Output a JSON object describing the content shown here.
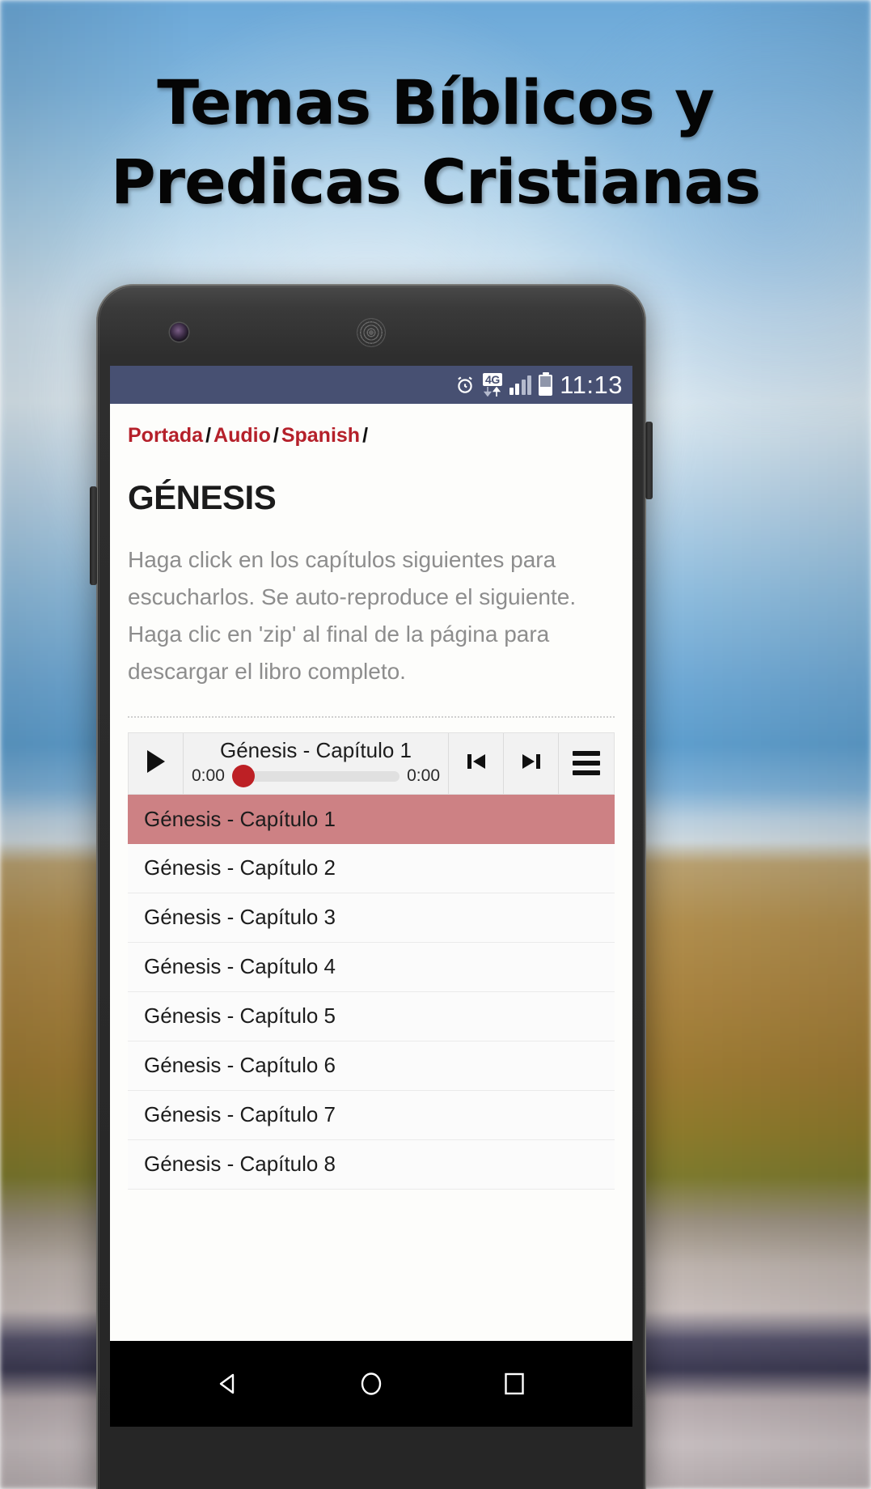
{
  "promo": {
    "headline": "Temas Bíblicos y Predicas Cristianas"
  },
  "statusbar": {
    "alarm_icon": "alarm-clock-icon",
    "network_label": "4G",
    "signal_icon": "signal-bars-icon",
    "battery_icon": "battery-icon",
    "time": "11:13",
    "background_color": "#475072"
  },
  "breadcrumb": {
    "items": [
      {
        "label": "Portada"
      },
      {
        "label": "Audio"
      },
      {
        "label": "Spanish"
      }
    ],
    "separator": "/",
    "link_color": "#b5202a"
  },
  "page": {
    "title": "GÉNESIS",
    "intro": "Haga click en los capítulos siguientes para escucharlos. Se auto-reproduce el siguiente. Haga clic en 'zip' al final de la página para descargar el libro completo."
  },
  "player": {
    "play_icon": "play-icon",
    "track_title": "Génesis - Capítulo 1",
    "elapsed": "0:00",
    "duration": "0:00",
    "progress_percent": 0,
    "knob_color": "#bd2025",
    "prev_icon": "skip-previous-icon",
    "next_icon": "skip-next-icon",
    "menu_icon": "hamburger-menu-icon"
  },
  "chapters": {
    "selected_index": 0,
    "selected_color": "#cd8184",
    "items": [
      {
        "label": "Génesis - Capítulo 1"
      },
      {
        "label": "Génesis - Capítulo 2"
      },
      {
        "label": "Génesis - Capítulo 3"
      },
      {
        "label": "Génesis - Capítulo 4"
      },
      {
        "label": "Génesis - Capítulo 5"
      },
      {
        "label": "Génesis - Capítulo 6"
      },
      {
        "label": "Génesis - Capítulo 7"
      },
      {
        "label": "Génesis - Capítulo 8"
      }
    ]
  },
  "navbar": {
    "back_icon": "back-triangle-icon",
    "home_icon": "home-circle-icon",
    "recents_icon": "recents-square-icon"
  }
}
